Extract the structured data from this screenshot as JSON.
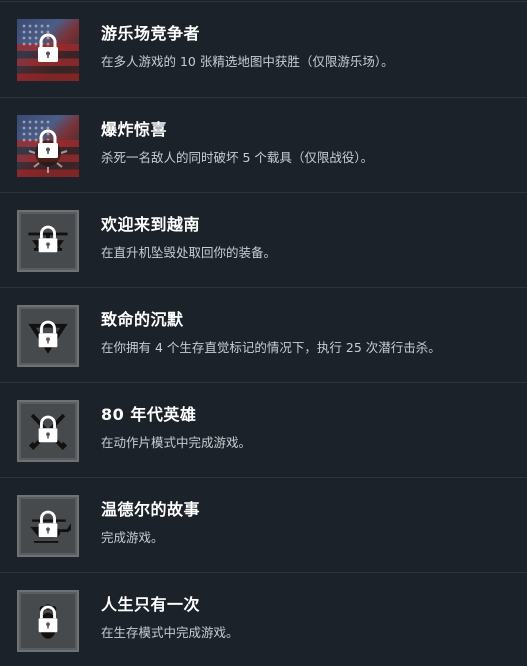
{
  "achievements": [
    {
      "title": "游乐场竞争者",
      "description": "在多人游戏的 10 张精选地图中获胜（仅限游乐场）。",
      "icon": "flag-lock-icon"
    },
    {
      "title": "爆炸惊喜",
      "description": "杀死一名敌人的同时破坏 5 个载具（仅限战役）。",
      "icon": "flag-explosion-lock-icon"
    },
    {
      "title": "欢迎来到越南",
      "description": "在直升机坠毁处取回你的装备。",
      "icon": "helicopter-lock-icon"
    },
    {
      "title": "致命的沉默",
      "description": "在你拥有 4 个生存直觉标记的情况下，执行 25 次潜行击杀。",
      "icon": "triangle-lock-icon"
    },
    {
      "title": "80 年代英雄",
      "description": "在动作片模式中完成游戏。",
      "icon": "crossed-rifles-lock-icon"
    },
    {
      "title": "温德尔的故事",
      "description": "完成游戏。",
      "icon": "helicopter-side-lock-icon"
    },
    {
      "title": "人生只有一次",
      "description": "在生存模式中完成游戏。",
      "icon": "footprint-lock-icon"
    }
  ],
  "colors": {
    "background": "#1b2229",
    "divider": "#2c353e",
    "title": "#ffffff",
    "description": "#c8cdd2"
  }
}
